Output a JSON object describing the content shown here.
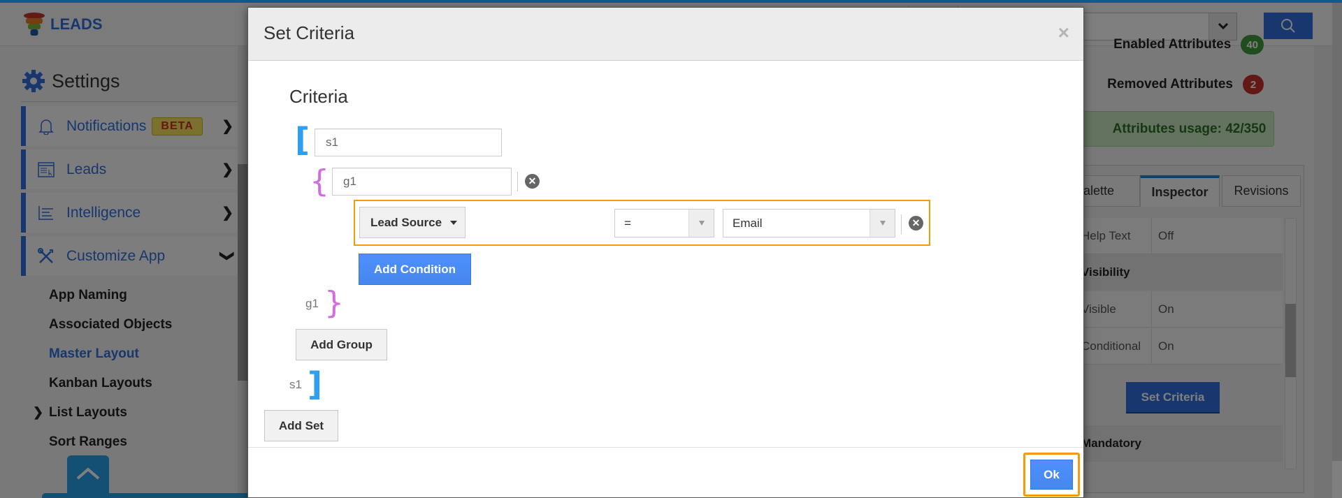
{
  "app": {
    "logo_text": "LEADS",
    "search_dropdown_icon": "chevron-down-icon",
    "search_button_icon": "search-icon"
  },
  "sidebar": {
    "title": "Settings",
    "title_icon": "gear-icon",
    "items": [
      {
        "label": "Notifications",
        "icon": "bell-icon",
        "badge": "BETA",
        "chevron": "chevron-right-icon"
      },
      {
        "label": "Leads",
        "icon": "window-list-icon",
        "chevron": "chevron-right-icon"
      },
      {
        "label": "Intelligence",
        "icon": "text-lines-icon",
        "chevron": "chevron-right-icon"
      },
      {
        "label": "Customize App",
        "icon": "wrench-screwdriver-icon",
        "chevron": "chevron-down-icon"
      }
    ],
    "sub_items": [
      {
        "label": "App Naming"
      },
      {
        "label": "Associated Objects"
      },
      {
        "label": "Master Layout",
        "active": true
      },
      {
        "label": "Kanban Layouts"
      },
      {
        "label": "List Layouts",
        "has_chevron": true
      },
      {
        "label": "Sort Ranges"
      }
    ],
    "scroll_up_icon": "chevron-up-icon"
  },
  "right_panel": {
    "enabled_attributes": {
      "label": "Enabled Attributes",
      "count": "40"
    },
    "removed_attributes": {
      "label": "Removed Attributes",
      "count": "2"
    },
    "usage": "Attributes usage: 42/350",
    "tabs": [
      {
        "label": "Palette"
      },
      {
        "label": "Inspector",
        "active": true
      },
      {
        "label": "Revisions"
      }
    ],
    "properties": [
      {
        "key": "Help Text",
        "value": "Off"
      },
      {
        "section": "Visibility"
      },
      {
        "key": "Visible",
        "value": "On"
      },
      {
        "key": "Conditional",
        "value": "On"
      },
      {
        "section": "Mandatory"
      }
    ],
    "set_criteria_button": "Set Criteria",
    "colors": {
      "enabled_badge": "#3f9b3a",
      "removed_badge": "#c9302c",
      "accent": "#2f6fdc"
    }
  },
  "modal": {
    "title": "Set Criteria",
    "close_icon": "close-icon",
    "heading": "Criteria",
    "set": {
      "open_bracket": "[",
      "close_bracket": "]",
      "name": "s1",
      "close_label": "s1",
      "group": {
        "open_brace": "{",
        "close_brace": "}",
        "name": "g1",
        "close_label": "g1",
        "remove_icon": "remove-circle-icon",
        "condition": {
          "field": "Lead Source",
          "operator": "=",
          "value": "Email",
          "remove_icon": "remove-circle-icon"
        },
        "add_condition_label": "Add Condition"
      },
      "add_group_label": "Add Group"
    },
    "add_set_label": "Add Set",
    "ok_label": "Ok",
    "highlight_color": "#f59b0b"
  }
}
